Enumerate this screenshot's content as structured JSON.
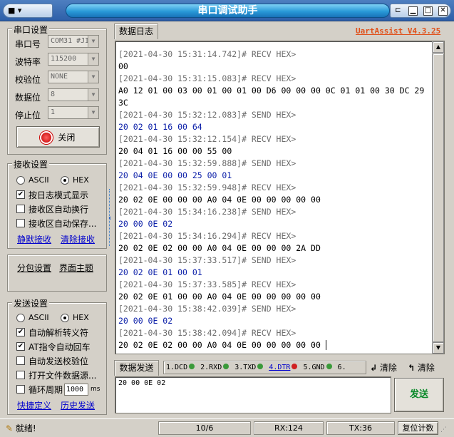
{
  "window": {
    "title": "串口调试助手",
    "sysmenu_icon": "window-menu-icon",
    "pin_icon": "pin-icon"
  },
  "app": {
    "version": "UartAssist V4.3.25",
    "accent": "#e0501a"
  },
  "serial_settings": {
    "title": "串口设置",
    "port_label": "串口号",
    "port_value": "COM31 #JI",
    "baud_label": "波特率",
    "baud_value": "115200",
    "parity_label": "校验位",
    "parity_value": "NONE",
    "databits_label": "数据位",
    "databits_value": "8",
    "stopbits_label": "停止位",
    "stopbits_value": "1",
    "close_button": "关闭"
  },
  "receive_settings": {
    "title": "接收设置",
    "ascii": "ASCII",
    "hex": "HEX",
    "log_mode": "按日志模式显示",
    "auto_wrap": "接收区自动换行",
    "auto_save": "接收区自动保存...",
    "silent_link": "静默接收",
    "clear_link": "清除接收"
  },
  "misc": {
    "packet_settings": "分包设置",
    "theme": "界面主题"
  },
  "send_settings": {
    "title": "发送设置",
    "ascii": "ASCII",
    "hex": "HEX",
    "auto_escape": "自动解析转义符",
    "at_newline": "AT指令自动回车",
    "auto_checksum": "自动发送校验位",
    "open_file": "打开文件数据源...",
    "loop_label": "循环周期",
    "loop_value": "1000",
    "loop_unit": "ms",
    "shortcut_link": "快捷定义",
    "history_link": "历史发送"
  },
  "log_tab": "数据日志",
  "log": [
    {
      "time": "[2021-04-30 15:31:14.742]# RECV HEX>",
      "data": "00",
      "dir": "recv"
    },
    {
      "time": "[2021-04-30 15:31:15.083]# RECV HEX>",
      "data": "A0 12 01 00 03 00 01 00 01 00 D6 00 00 00 0C 01 01 00 30 DC 29 3C",
      "dir": "recv"
    },
    {
      "time": "[2021-04-30 15:32:12.083]# SEND HEX>",
      "data": "20 02 01 16 00 64",
      "dir": "send"
    },
    {
      "time": "[2021-04-30 15:32:12.154]# RECV HEX>",
      "data": "20 04 01 16 00 00 55 00",
      "dir": "recv"
    },
    {
      "time": "[2021-04-30 15:32:59.888]# SEND HEX>",
      "data": "20 04 0E 00 00 25 00 01",
      "dir": "send"
    },
    {
      "time": "[2021-04-30 15:32:59.948]# RECV HEX>",
      "data": "20 02 0E 00 00 00 A0 04 0E 00 00 00 00 00",
      "dir": "recv"
    },
    {
      "time": "[2021-04-30 15:34:16.238]# SEND HEX>",
      "data": "20 00 0E 02",
      "dir": "send"
    },
    {
      "time": "[2021-04-30 15:34:16.294]# RECV HEX>",
      "data": "20 02 0E 02 00 00 A0 04 0E 00 00 00 2A DD",
      "dir": "recv"
    },
    {
      "time": "[2021-04-30 15:37:33.517]# SEND HEX>",
      "data": "20 02 0E 01 00 01",
      "dir": "send"
    },
    {
      "time": "[2021-04-30 15:37:33.585]# RECV HEX>",
      "data": "20 02 0E 01 00 00 A0 04 0E 00 00 00 00 00",
      "dir": "recv"
    },
    {
      "time": "[2021-04-30 15:38:42.039]# SEND HEX>",
      "data": "20 00 0E 02",
      "dir": "send"
    },
    {
      "time": "[2021-04-30 15:38:42.094]# RECV HEX>",
      "data": "20 02 0E 02 00 00 A0 04 0E 00 00 00 00 00 ",
      "dir": "recv"
    }
  ],
  "send_panel": {
    "tab": "数据发送",
    "pins": [
      {
        "label": "1.DCD",
        "color": "#3a9a3a"
      },
      {
        "label": "2.RXD",
        "color": "#3a9a3a"
      },
      {
        "label": "3.TXD",
        "color": "#3a9a3a"
      },
      {
        "label": "4.DTR",
        "color": "#d02020",
        "active": true
      },
      {
        "label": "5.GND",
        "color": "#3a9a3a"
      },
      {
        "label": "6.",
        "color": "#3a9a3a"
      }
    ],
    "clear1": "清除",
    "clear2": "清除",
    "input_value": "20 00 0E 02",
    "send_button": "发送",
    "send_color": "#0a8a2a"
  },
  "status": {
    "ready": "就绪!",
    "count": "10/6",
    "rx": "RX:124",
    "tx": "TX:36",
    "reset": "复位计数"
  }
}
